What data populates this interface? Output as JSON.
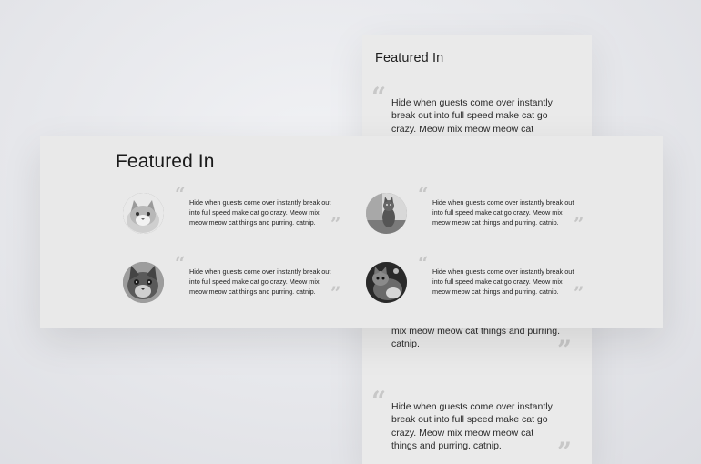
{
  "background_card": {
    "title": "Featured In",
    "quotes": [
      {
        "text": "Hide when guests come over instantly break out into full speed make cat go crazy. Meow mix meow meow cat things and purring.",
        "open_mark": "“",
        "close_mark": ""
      },
      {
        "text": "mix meow meow cat things and purring. catnip.",
        "open_mark": "",
        "close_mark": "”"
      },
      {
        "text": "Hide when guests come over instantly break out into full speed make cat go crazy. Meow mix meow meow cat things and purring. catnip.",
        "open_mark": "“",
        "close_mark": "”"
      }
    ]
  },
  "featured_section": {
    "title": "Featured In",
    "testimonials": [
      {
        "text": "Hide when guests come over instantly break out into full speed make cat go crazy. Meow mix meow meow cat things and purring. catnip.",
        "avatar": "cat-photo-1",
        "open_mark": "“",
        "close_mark": "”"
      },
      {
        "text": "Hide when guests come over instantly break out into full speed make cat go crazy. Meow mix meow meow cat things and purring. catnip.",
        "avatar": "cat-photo-2",
        "open_mark": "“",
        "close_mark": "”"
      },
      {
        "text": "Hide when guests come over instantly break out into full speed make cat go crazy. Meow mix meow meow cat things and purring. catnip.",
        "avatar": "cat-photo-3",
        "open_mark": "“",
        "close_mark": "”"
      },
      {
        "text": "Hide when guests come over instantly break out into full speed make cat go crazy. Meow mix meow meow cat things and purring. catnip.",
        "avatar": "cat-photo-4",
        "open_mark": "“",
        "close_mark": "”"
      }
    ]
  },
  "colors": {
    "page_background": "#e6e7eb",
    "card_background": "#e9e9e9",
    "quote_mark": "#c6c6c6",
    "text": "#222222"
  }
}
